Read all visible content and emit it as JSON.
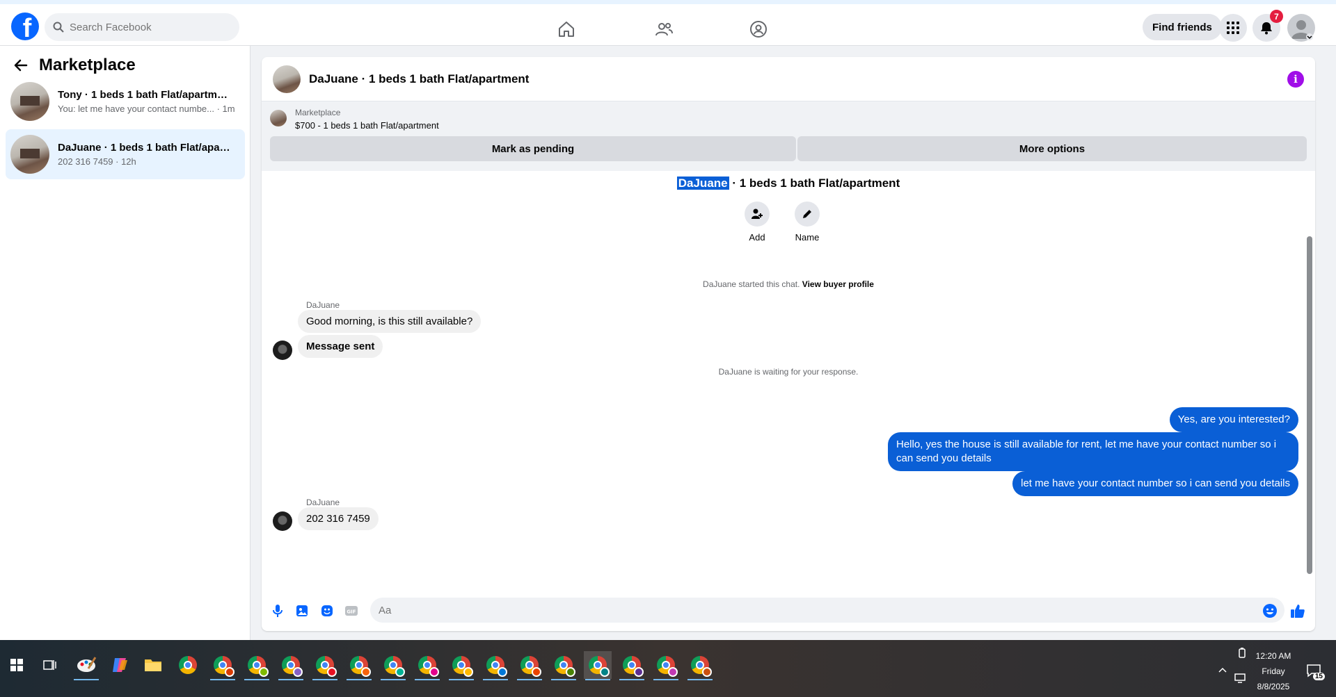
{
  "topbar": {
    "search_placeholder": "Search Facebook",
    "find_friends": "Find friends",
    "notification_count": "7"
  },
  "sidebar": {
    "title": "Marketplace",
    "conversations": [
      {
        "title": "Tony · 1 beds 1 bath Flat/apartment",
        "subtitle": "You: let me have your contact numbe... · 1m"
      },
      {
        "title": "DaJuane · 1 beds 1 bath Flat/apartment",
        "subtitle": "202 316 7459 · 12h"
      }
    ]
  },
  "chat": {
    "header_name": "DaJuane · 1 beds 1 bath Flat/apartment",
    "listing_label": "Marketplace",
    "listing_price_title": "$700 - 1 beds 1 bath Flat/apartment",
    "mark_pending": "Mark as pending",
    "more_options": "More options",
    "intro_name": "DaJuane",
    "intro_rest": " · 1 beds 1 bath Flat/apartment",
    "action_add": "Add",
    "action_name": "Name",
    "started_text": "DaJuane started this chat.",
    "view_buyer": "View buyer profile",
    "sender1": "DaJuane",
    "msg_in_1": "Good morning, is this still available?",
    "msg_in_2": "Message sent",
    "waiting": "DaJuane is waiting for your response.",
    "msg_out_1": "Yes, are you interested?",
    "msg_out_2": "Hello, yes the house is still available for rent, let me have your contact number so i can send you details",
    "msg_out_3": "let me have your contact number so i can send you details",
    "sender2": "DaJuane",
    "msg_in_3": "202 316 7459",
    "composer_placeholder": "Aa"
  },
  "taskbar": {
    "time": "12:20 AM",
    "day": "Friday",
    "date": "8/8/2025",
    "notification_count": "15"
  },
  "colors": {
    "accent": "#0866ff",
    "outgoing_bubble": "#0a5fd6",
    "badge": "#e41e3f",
    "info": "#a00ee8"
  }
}
